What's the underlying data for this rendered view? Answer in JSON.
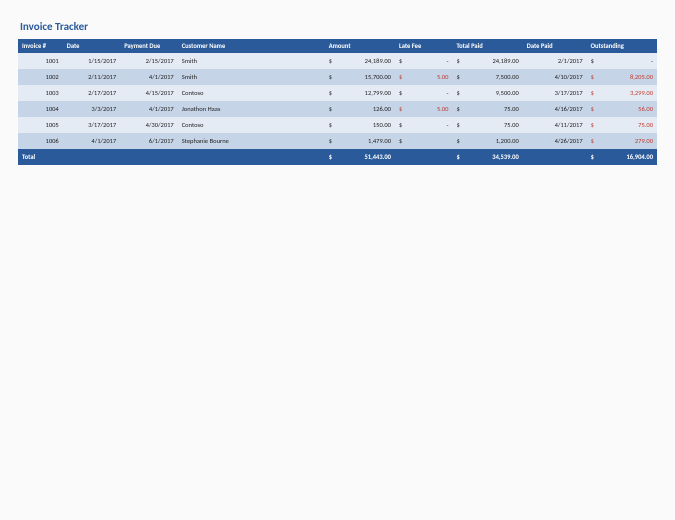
{
  "title": "Invoice Tracker",
  "headers": {
    "invoice": "Invoice #",
    "date": "Date",
    "payment_due": "Payment Due",
    "customer": "Customer Name",
    "amount": "Amount",
    "late_fee": "Late Fee",
    "total_paid": "Total Paid",
    "date_paid": "Date Paid",
    "outstanding": "Outstanding"
  },
  "rows": [
    {
      "invoice": "1001",
      "date": "1/15/2017",
      "payment_due": "2/15/2017",
      "customer": "Smith",
      "amount": "24,189.00",
      "late_fee": "-",
      "late_neg": false,
      "fee_sym_neg": false,
      "total_paid": "24,189.00",
      "date_paid": "2/1/2017",
      "outstanding": "-",
      "out_neg": false
    },
    {
      "invoice": "1002",
      "date": "2/11/2017",
      "payment_due": "4/1/2017",
      "customer": "Smith",
      "amount": "15,700.00",
      "late_fee": "5.00",
      "late_neg": true,
      "fee_sym_neg": true,
      "total_paid": "7,500.00",
      "date_paid": "4/10/2017",
      "outstanding": "8,205.00",
      "out_neg": true
    },
    {
      "invoice": "1003",
      "date": "2/17/2017",
      "payment_due": "4/15/2017",
      "customer": "Contoso",
      "amount": "12,799.00",
      "late_fee": "-",
      "late_neg": false,
      "fee_sym_neg": false,
      "total_paid": "9,500.00",
      "date_paid": "3/17/2017",
      "outstanding": "3,299.00",
      "out_neg": true
    },
    {
      "invoice": "1004",
      "date": "3/3/2017",
      "payment_due": "4/1/2017",
      "customer": "Jonathon Haas",
      "amount": "126.00",
      "late_fee": "5.00",
      "late_neg": true,
      "fee_sym_neg": true,
      "total_paid": "75.00",
      "date_paid": "4/16/2017",
      "outstanding": "56.00",
      "out_neg": true
    },
    {
      "invoice": "1005",
      "date": "3/17/2017",
      "payment_due": "4/30/2017",
      "customer": "Contoso",
      "amount": "150.00",
      "late_fee": "-",
      "late_neg": false,
      "fee_sym_neg": false,
      "total_paid": "75.00",
      "date_paid": "4/11/2017",
      "outstanding": "75.00",
      "out_neg": true
    },
    {
      "invoice": "1006",
      "date": "4/1/2017",
      "payment_due": "6/1/2017",
      "customer": "Stephanie Bourne",
      "amount": "1,479.00",
      "late_fee": "",
      "late_neg": false,
      "fee_sym_neg": false,
      "total_paid": "1,200.00",
      "date_paid": "4/26/2017",
      "outstanding": "279.00",
      "out_neg": true
    }
  ],
  "totals": {
    "label": "Total",
    "amount": "51,443.00",
    "total_paid": "34,539.00",
    "outstanding": "16,904.00"
  },
  "currency": "$"
}
